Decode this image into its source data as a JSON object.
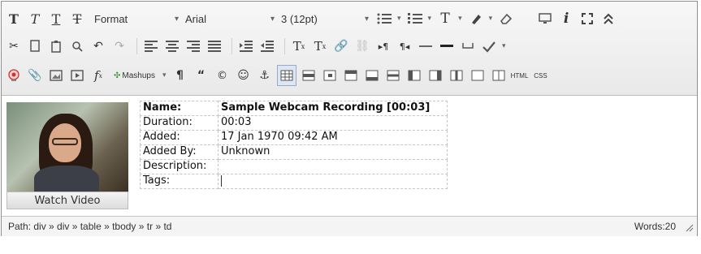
{
  "toolbar": {
    "format_label": "Format",
    "font_label": "Arial",
    "size_label": "3 (12pt)",
    "mashups_label": "Mashups",
    "html_label": "HTML",
    "css_label": "CSS"
  },
  "recording": {
    "watch_label": "Watch Video",
    "rows": [
      {
        "key": "Name:",
        "value": "Sample Webcam Recording [00:03]"
      },
      {
        "key": "Duration:",
        "value": "00:03"
      },
      {
        "key": "Added:",
        "value": "17 Jan 1970 09:42 AM"
      },
      {
        "key": "Added By:",
        "value": "Unknown"
      },
      {
        "key": "Description:",
        "value": ""
      },
      {
        "key": "Tags:",
        "value": ""
      }
    ]
  },
  "status": {
    "path": "Path: div » div » table » tbody » tr » td",
    "words": "Words:20"
  }
}
